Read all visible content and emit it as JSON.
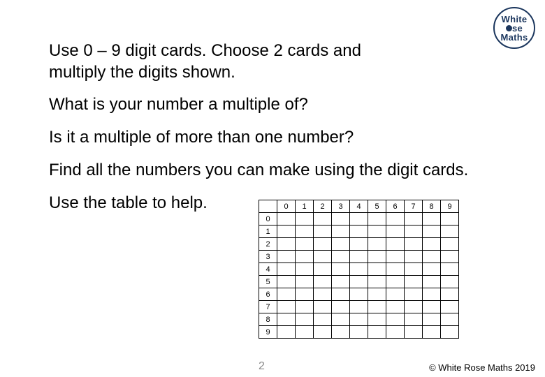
{
  "logo": {
    "line1": "White",
    "line2_suffix": "se",
    "line3": "Maths"
  },
  "paragraphs": {
    "p1": "Use 0 – 9 digit cards. Choose 2 cards and multiply the digits shown.",
    "p2": "What is your number a multiple of?",
    "p3": "Is it a multiple of more than one number?",
    "p4": "Find all the numbers you can make using the digit cards.",
    "p5": "Use the table to help."
  },
  "table": {
    "col_headers": [
      "0",
      "1",
      "2",
      "3",
      "4",
      "5",
      "6",
      "7",
      "8",
      "9"
    ],
    "row_headers": [
      "0",
      "1",
      "2",
      "3",
      "4",
      "5",
      "6",
      "7",
      "8",
      "9"
    ]
  },
  "page_number": "2",
  "copyright": "© White Rose Maths 2019"
}
